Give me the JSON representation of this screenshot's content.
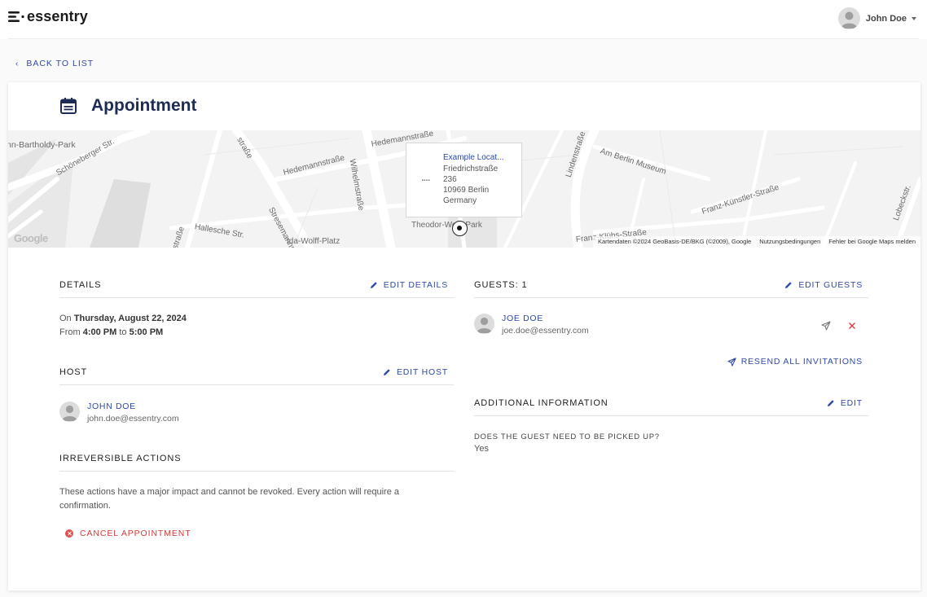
{
  "header": {
    "logo_text": "essentry",
    "user_name": "John Doe"
  },
  "back_label": "BACK TO LIST",
  "page_title": "Appointment",
  "map": {
    "popup": {
      "name": "Example Locat...",
      "street": "Friedrichstraße",
      "number": "236",
      "city": "10969 Berlin",
      "country": "Germany"
    },
    "street_labels": [
      "nn-Bartholdy-Park",
      "Schöneberger Str.",
      "Hedemannstraße",
      "Hedemannstraße",
      "Stresemannstraße",
      "Wilhelmstraße",
      "Lindenstraße",
      "Am Berlin Museum",
      "Franz-Künstler-Straße",
      "Franz-Klühs-Straße",
      "Hallesche Str.",
      "Ida-Wolff-Platz",
      "Theodor-Wolff-Park",
      "Lobeckstr.",
      "straße",
      "straße"
    ],
    "google_logo": "Google",
    "attribution": [
      "Kartendaten ©2024 GeoBasis-DE/BKG (©2009), Google",
      "Nutzungsbedingungen",
      "Fehler bei Google Maps melden"
    ]
  },
  "details": {
    "title": "DETAILS",
    "edit_label": "EDIT DETAILS",
    "on_prefix": "On",
    "date": "Thursday, August 22, 2024",
    "from_prefix": "From",
    "start_time": "4:00 PM",
    "to_word": "to",
    "end_time": "5:00 PM"
  },
  "host": {
    "title": "HOST",
    "edit_label": "EDIT HOST",
    "name": "JOHN DOE",
    "email": "john.doe@essentry.com"
  },
  "irreversible": {
    "title": "IRREVERSIBLE ACTIONS",
    "line1": "These actions have a major impact and cannot be revoked. Every action will require a",
    "line2": "confirmation.",
    "cancel_label": "CANCEL APPOINTMENT"
  },
  "guests": {
    "title": "GUESTS: 1",
    "edit_label": "EDIT GUESTS",
    "list": [
      {
        "name": "JOE DOE",
        "email": "joe.doe@essentry.com"
      }
    ],
    "resend_label": "RESEND ALL INVITATIONS"
  },
  "additional": {
    "title": "ADDITIONAL INFORMATION",
    "edit_label": "EDIT",
    "question": "DOES THE GUEST NEED TO BE PICKED UP?",
    "answer": "Yes"
  },
  "colors": {
    "accent": "#2e4aa6",
    "title": "#1e2b55",
    "danger": "#d23b3b"
  }
}
